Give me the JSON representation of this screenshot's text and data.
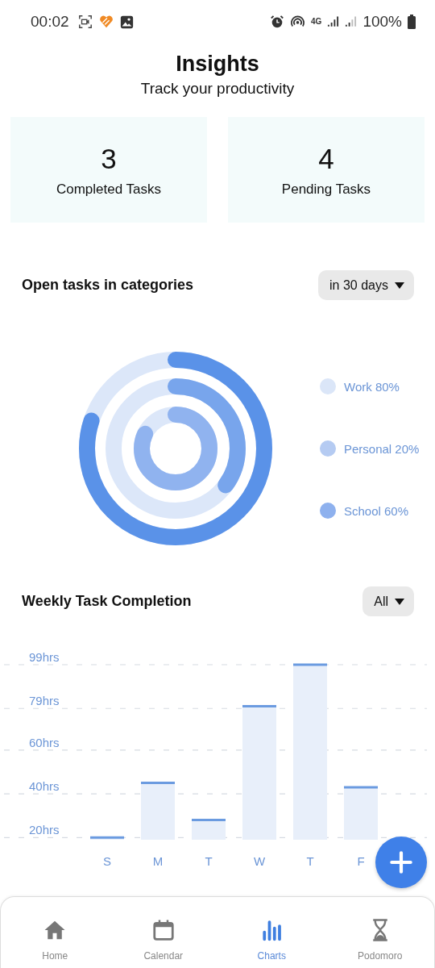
{
  "status_bar": {
    "time": "00:02",
    "network": "4G",
    "battery": "100%"
  },
  "header": {
    "title": "Insights",
    "subtitle": "Track your productivity"
  },
  "stats": [
    {
      "value": "3",
      "label": "Completed Tasks"
    },
    {
      "value": "4",
      "label": "Pending Tasks"
    }
  ],
  "categories": {
    "title": "Open tasks in categories",
    "filter": "in 30 days",
    "legend": [
      {
        "label": "Work 80%",
        "color": "#dbe6f8"
      },
      {
        "label": "Personal 20%",
        "color": "#b5cbf2"
      },
      {
        "label": "School 60%",
        "color": "#8eb1ee"
      }
    ]
  },
  "weekly": {
    "title": "Weekly Task Completion",
    "filter": "All",
    "chart_data": {
      "type": "bar",
      "grid": true,
      "categories": [
        "S",
        "M",
        "T",
        "W",
        "T",
        "F"
      ],
      "ylim": [
        19,
        99
      ],
      "yticks": [
        {
          "value": 20,
          "label": "20hrs"
        },
        {
          "value": 40,
          "label": "40hrs"
        },
        {
          "value": 60,
          "label": "60hrs"
        },
        {
          "value": 79,
          "label": "79hrs"
        },
        {
          "value": 99,
          "label": "99hrs"
        }
      ],
      "values": [
        20,
        45,
        28,
        80,
        99,
        43
      ]
    }
  },
  "nav": [
    {
      "label": "Home",
      "selected": false
    },
    {
      "label": "Calendar",
      "selected": false
    },
    {
      "label": "Charts",
      "selected": true
    },
    {
      "label": "Podomoro",
      "selected": false
    }
  ]
}
